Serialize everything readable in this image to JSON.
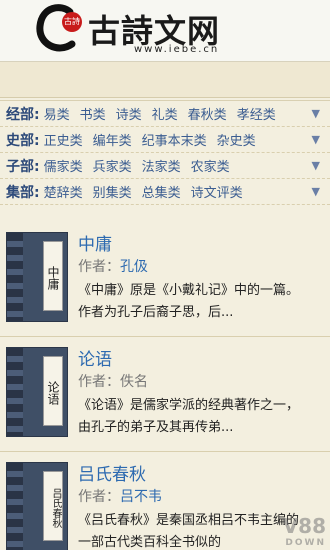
{
  "header": {
    "seal_text": "古詩",
    "title": "古詩文网",
    "url": "www.iebe.cn"
  },
  "categories": [
    {
      "label": "经部:",
      "items": [
        "易类",
        "书类",
        "诗类",
        "礼类",
        "春秋类",
        "孝经类"
      ]
    },
    {
      "label": "史部:",
      "items": [
        "正史类",
        "编年类",
        "纪事本末类",
        "杂史类"
      ]
    },
    {
      "label": "子部:",
      "items": [
        "儒家类",
        "兵家类",
        "法家类",
        "农家类"
      ]
    },
    {
      "label": "集部:",
      "items": [
        "楚辞类",
        "别集类",
        "总集类",
        "诗文评类"
      ]
    }
  ],
  "books": [
    {
      "cover_text": "中庸",
      "title": "中庸",
      "author_label": "作者：",
      "author": "孔伋",
      "desc_line1": "《中庸》原是《小戴礼记》中的一篇。",
      "desc_line2": "作者为孔子后裔子思，后..."
    },
    {
      "cover_text": "论语",
      "title": "论语",
      "author_label": "作者：",
      "author": "佚名",
      "desc_line1": "《论语》是儒家学派的经典著作之一，",
      "desc_line2": "由孔子的弟子及其再传弟..."
    },
    {
      "cover_text": "吕氏春秋",
      "title": "吕氏春秋",
      "author_label": "作者：",
      "author": "吕不韦",
      "desc_line1": "《吕氏春秋》是秦国丞相吕不韦主编的",
      "desc_line2": "一部古代类百科全书似的"
    }
  ],
  "watermark": {
    "brand": "V88",
    "sub": "DOWN"
  },
  "colors": {
    "link": "#2d6ab0",
    "background": "#f3efdf",
    "seal": "#c81b1b"
  }
}
